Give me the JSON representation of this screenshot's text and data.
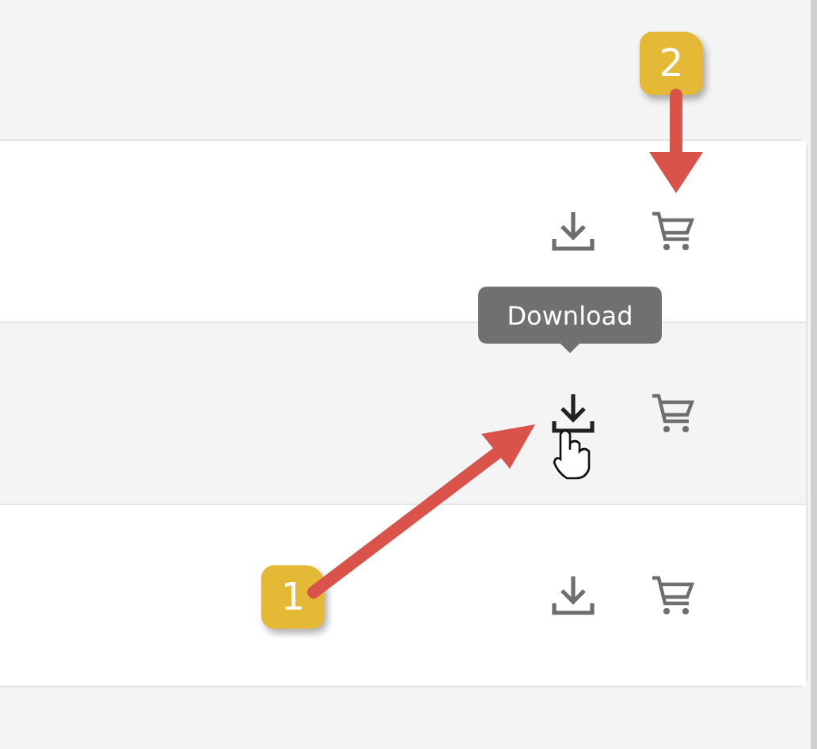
{
  "rows": [
    {
      "hovered": false
    },
    {
      "hovered": true
    },
    {
      "hovered": false
    }
  ],
  "tooltip": {
    "text": "Download"
  },
  "annotations": [
    {
      "label": "1"
    },
    {
      "label": "2"
    }
  ]
}
